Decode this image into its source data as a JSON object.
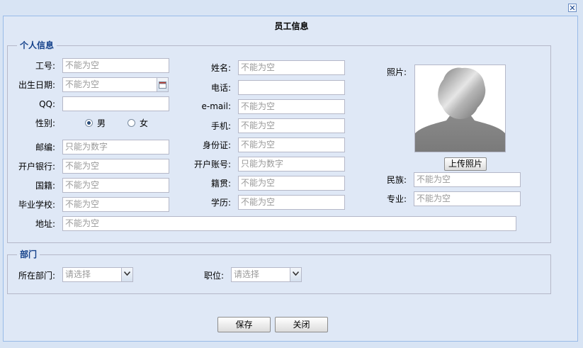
{
  "window": {
    "title": "员工信息",
    "close_glyph": "✕"
  },
  "personal": {
    "legend": "个人信息",
    "emp_no": {
      "label": "工号:",
      "placeholder": "不能为空"
    },
    "birthdate": {
      "label": "出生日期:",
      "placeholder": "不能为空"
    },
    "qq": {
      "label": "QQ:",
      "placeholder": ""
    },
    "gender": {
      "label": "性别:",
      "options": [
        "男",
        "女"
      ],
      "selected": "男"
    },
    "postcode": {
      "label": "邮编:",
      "placeholder": "只能为数字"
    },
    "bank": {
      "label": "开户银行:",
      "placeholder": "不能为空"
    },
    "nationality": {
      "label": "国籍:",
      "placeholder": "不能为空"
    },
    "school": {
      "label": "毕业学校:",
      "placeholder": "不能为空"
    },
    "address": {
      "label": "地址:",
      "placeholder": "不能为空"
    },
    "name": {
      "label": "姓名:",
      "placeholder": "不能为空"
    },
    "phone": {
      "label": "电话:",
      "placeholder": ""
    },
    "email": {
      "label": "e-mail:",
      "placeholder": "不能为空"
    },
    "mobile": {
      "label": "手机:",
      "placeholder": "不能为空"
    },
    "id_card": {
      "label": "身份证:",
      "placeholder": "不能为空"
    },
    "account": {
      "label": "开户账号:",
      "placeholder": "只能为数字"
    },
    "native_place": {
      "label": "籍贯:",
      "placeholder": "不能为空"
    },
    "education": {
      "label": "学历:",
      "placeholder": "不能为空"
    },
    "photo": {
      "label": "照片:",
      "upload_label": "上传照片"
    },
    "ethnicity": {
      "label": "民族:",
      "placeholder": "不能为空"
    },
    "major": {
      "label": "专业:",
      "placeholder": "不能为空"
    }
  },
  "department": {
    "legend": "部门",
    "dept": {
      "label": "所在部门:",
      "value": "请选择"
    },
    "position": {
      "label": "职位:",
      "value": "请选择"
    }
  },
  "buttons": {
    "save": "保存",
    "close": "关闭"
  },
  "icons": {
    "calendar": "calendar-icon",
    "dropdown": "chevron-down-icon",
    "close": "close-icon"
  }
}
